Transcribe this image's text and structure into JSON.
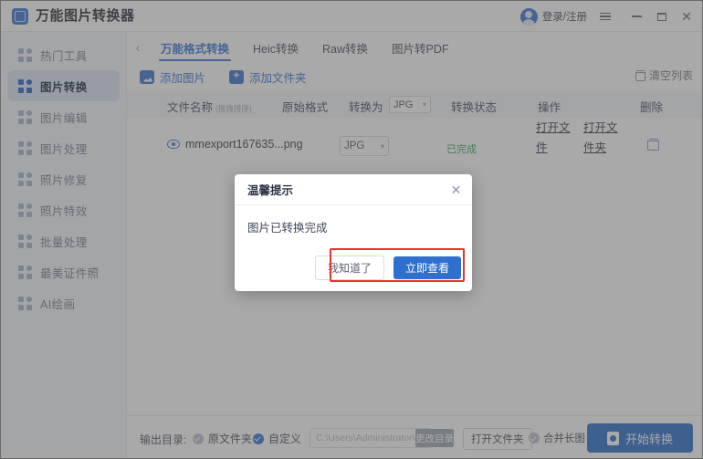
{
  "window": {
    "app_title": "万能图片转换器",
    "app_icon": "app-logo-icon",
    "account_label": "登录/注册",
    "menu_icon": "hamburger-menu-icon",
    "minimize_icon": "minimize-icon",
    "maximize_icon": "maximize-icon",
    "close_icon": "close-icon",
    "close_glyph": "✕"
  },
  "sidebar": {
    "items": [
      {
        "label": "热门工具",
        "active": false
      },
      {
        "label": "图片转换",
        "active": true
      },
      {
        "label": "图片编辑",
        "active": false
      },
      {
        "label": "图片处理",
        "active": false
      },
      {
        "label": "照片修复",
        "active": false
      },
      {
        "label": "照片特效",
        "active": false
      },
      {
        "label": "批量处理",
        "active": false
      },
      {
        "label": "最美证件照",
        "active": false
      },
      {
        "label": "AI绘画",
        "active": false
      }
    ]
  },
  "tabs": {
    "back_glyph": "‹",
    "items": [
      {
        "label": "万能格式转换",
        "active": true
      },
      {
        "label": "Heic转换",
        "active": false
      },
      {
        "label": "Raw转换",
        "active": false
      },
      {
        "label": "图片转PDF",
        "active": false
      }
    ]
  },
  "toolbar": {
    "add_image": "添加图片",
    "add_folder": "添加文件夹",
    "clear_list": "清空列表"
  },
  "table": {
    "headers": {
      "filename": "文件名称",
      "filename_hint": "(拖拽排序)",
      "source_format": "原始格式",
      "convert_to": "转换为",
      "convert_to_value": "JPG",
      "status": "转换状态",
      "action": "操作",
      "delete": "删除"
    },
    "rows": [
      {
        "checked": true,
        "preview_icon": "eye-icon",
        "filename": "mmexport167635...png",
        "source_format": "",
        "target_format": "JPG",
        "status": "已完成",
        "status_color": "#37a05a",
        "action_open_file": "打开文件",
        "action_open_folder": "打开文件夹",
        "delete_icon": "trash-icon"
      }
    ]
  },
  "bottom": {
    "output_dir_label": "输出目录:",
    "radio_original": "原文件夹",
    "radio_custom": "自定义",
    "custom_selected": true,
    "path_value": "C:\\Users\\Administrator\\...",
    "change_dir": "更改目录",
    "open_folder": "打开文件夹",
    "merge_long_image": "合并长图",
    "merge_checked": false,
    "start_convert": "开始转换"
  },
  "dialog": {
    "title": "温馨提示",
    "close_glyph": "✕",
    "message": "图片已转换完成",
    "secondary_button": "我知道了",
    "primary_button": "立即查看"
  },
  "annotation": {
    "shape": "rectangle",
    "color": "#e8342a"
  },
  "colors": {
    "accent": "#2f6fd0",
    "primary_button": "#2068c8",
    "success": "#37a05a",
    "annotation": "#e8342a",
    "sidebar_active_bg": "#dbe6f7"
  }
}
